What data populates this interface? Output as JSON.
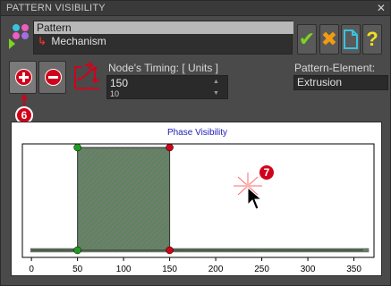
{
  "window": {
    "title": "PATTERN VISIBILITY",
    "close_label": "✕"
  },
  "tree": {
    "items": [
      "Pattern",
      "Mechanism"
    ]
  },
  "toolbar": {
    "ok_label": "✔",
    "cancel_label": "✖",
    "doc_icon": "document-icon",
    "help_label": "?"
  },
  "controls": {
    "add_label": "add-node",
    "remove_label": "remove-node",
    "timing_label": "Node's Timing: [ Units ]",
    "timing_value": "150",
    "timing_step": "10",
    "pattern_element_label": "Pattern-Element:",
    "pattern_element_value": "Extrusion"
  },
  "callouts": {
    "add_badge": "6",
    "plot_badge": "7"
  },
  "colors": {
    "accent_red": "#d0021b",
    "node_green": "#1f9c1f",
    "title_blue": "#1b1bb5"
  },
  "chart_data": {
    "type": "area",
    "title": "Phase Visibility",
    "xlabel": "",
    "ylabel": "",
    "xlim": [
      -5,
      365
    ],
    "ylim": [
      0,
      1
    ],
    "xticks": [
      0,
      50,
      100,
      150,
      200,
      250,
      300,
      350
    ],
    "series": [
      {
        "x": [
          0,
          50,
          50,
          150,
          150,
          360
        ],
        "y": [
          0,
          0,
          1,
          1,
          0,
          0
        ]
      }
    ],
    "nodes": [
      {
        "x": 50,
        "y": 1,
        "color": "green"
      },
      {
        "x": 150,
        "y": 1,
        "color": "red"
      },
      {
        "x": 50,
        "y": 0,
        "color": "green"
      },
      {
        "x": 150,
        "y": 0,
        "color": "red"
      }
    ],
    "grid": false,
    "legend": "none"
  }
}
